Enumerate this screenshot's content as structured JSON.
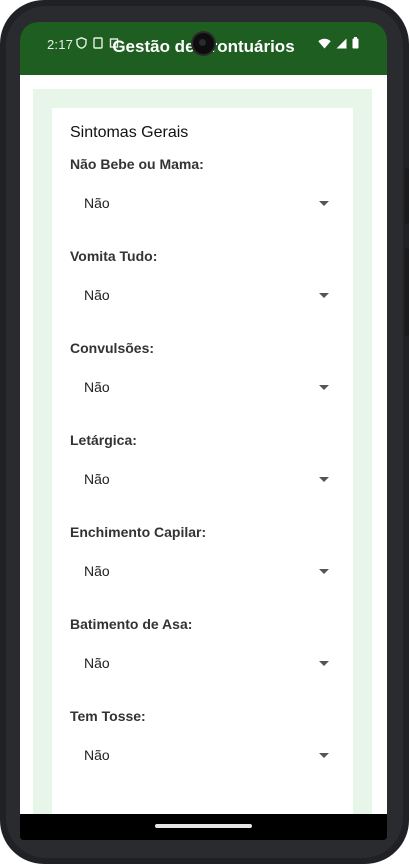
{
  "status_bar": {
    "time": "2:17"
  },
  "app_bar": {
    "title": "Gestão de Prontuários"
  },
  "section": {
    "title": "Sintomas Gerais",
    "fields": [
      {
        "label": "Não Bebe ou Mama:",
        "value": "Não"
      },
      {
        "label": "Vomita Tudo:",
        "value": "Não"
      },
      {
        "label": "Convulsões:",
        "value": "Não"
      },
      {
        "label": "Letárgica:",
        "value": "Não"
      },
      {
        "label": "Enchimento Capilar:",
        "value": "Não"
      },
      {
        "label": "Batimento de Asa:",
        "value": "Não"
      },
      {
        "label": "Tem Tosse:",
        "value": "Não"
      }
    ]
  },
  "colors": {
    "app_bar": "#1e5e20",
    "panel_background": "#e8f5e9"
  },
  "icons": {
    "status_left": [
      "shield-icon",
      "sim-icon",
      "square-icon"
    ],
    "status_right": [
      "wifi-icon",
      "signal-icon",
      "battery-icon"
    ],
    "dropdown": "caret-down-icon"
  }
}
